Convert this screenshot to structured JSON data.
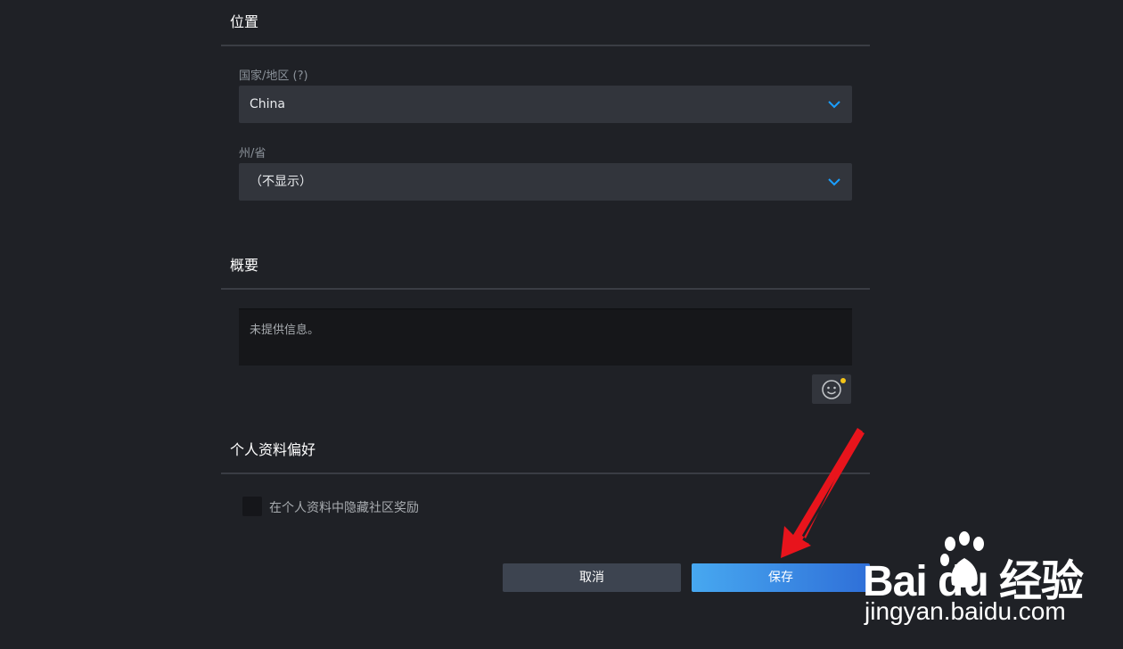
{
  "location": {
    "title": "位置",
    "country_label": "国家/地区 (?)",
    "country_value": "China",
    "state_label": "州/省",
    "state_value": "（不显示）"
  },
  "summary": {
    "title": "概要",
    "placeholder": "未提供信息。"
  },
  "preferences": {
    "title": "个人资料偏好",
    "hide_awards_label": "在个人资料中隐藏社区奖励"
  },
  "actions": {
    "cancel_label": "取消",
    "save_label": "保存"
  },
  "watermark": {
    "brand": "Bai  du 经验",
    "url": "jingyan.baidu.com"
  },
  "colors": {
    "accent": "#1a9fff",
    "arrow": "#e8141c"
  }
}
